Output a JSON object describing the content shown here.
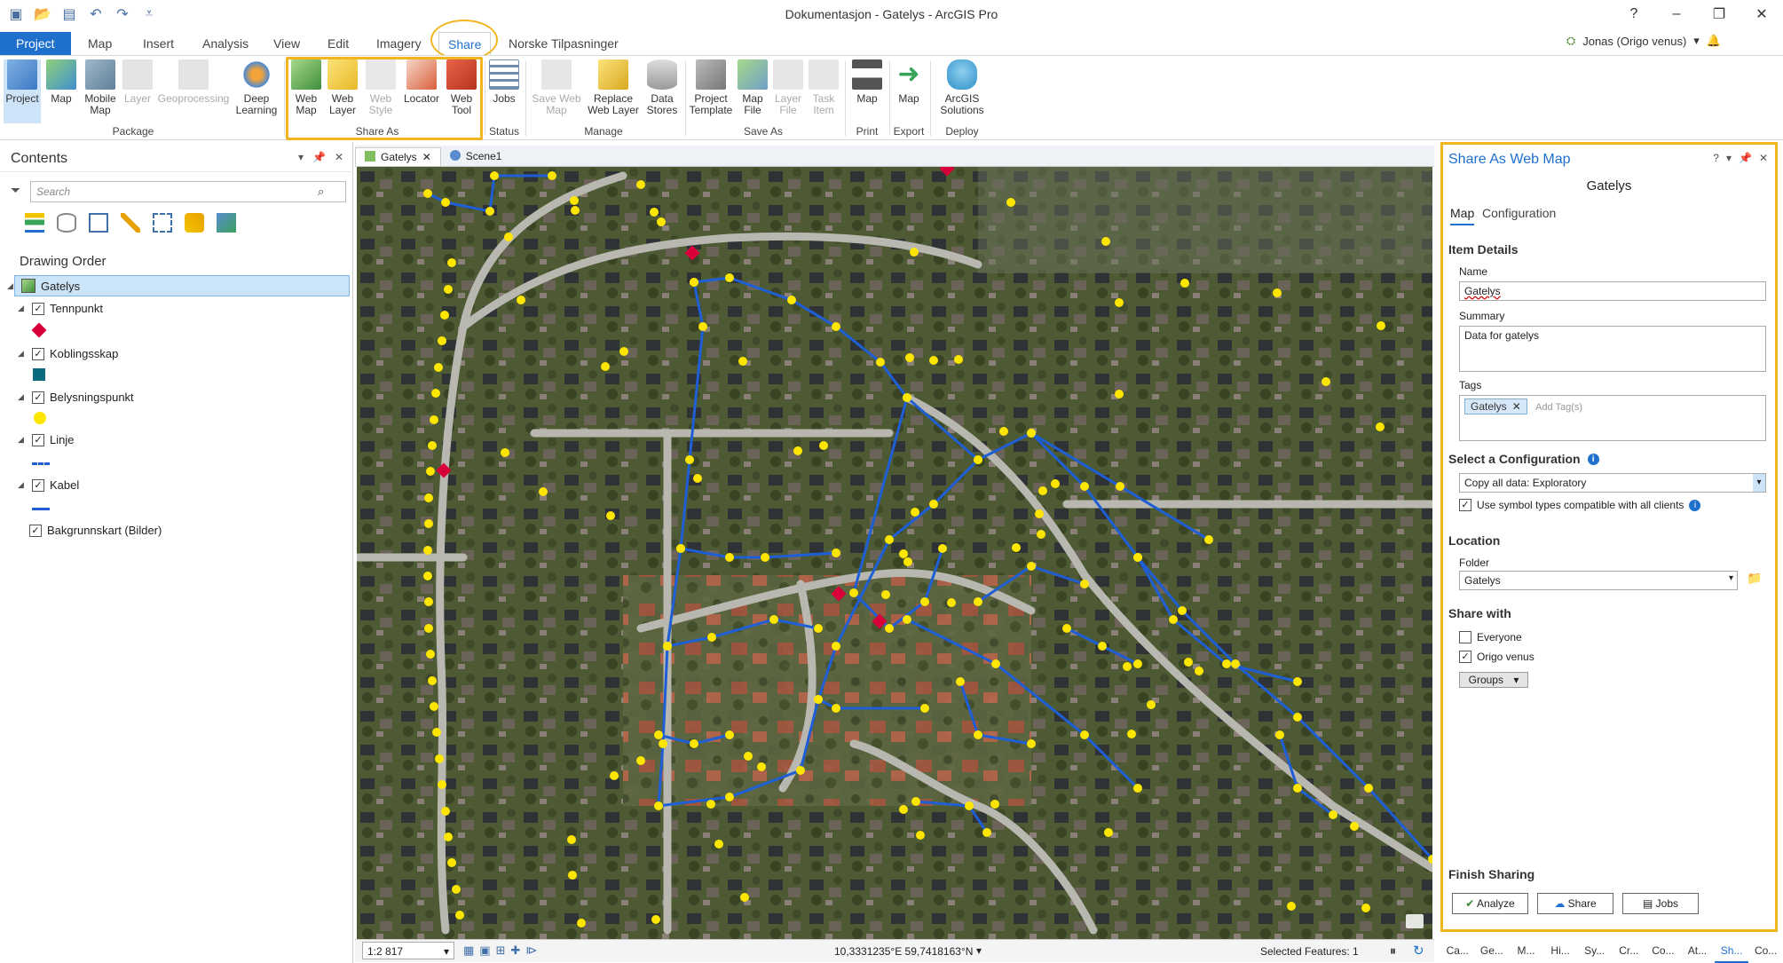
{
  "window": {
    "title": "Dokumentasjon - Gatelys - ArcGIS Pro",
    "help": "?",
    "minimize": "–",
    "restore": "❐",
    "close": "✕"
  },
  "tabs": [
    "Project",
    "Map",
    "Insert",
    "Analysis",
    "View",
    "Edit",
    "Imagery",
    "Share",
    "Norske Tilpasninger"
  ],
  "user": "Jonas (Origo venus)",
  "ribbon": {
    "package": {
      "label": "Package",
      "buttons": [
        "Project",
        "Map",
        "Mobile Map",
        "Layer",
        "Geoprocessing",
        "Deep Learning"
      ]
    },
    "share_as": {
      "label": "Share As",
      "buttons": [
        "Web Map",
        "Web Layer",
        "Web Style",
        "Locator",
        "Web Tool"
      ]
    },
    "status": {
      "label": "Status",
      "buttons": [
        "Jobs"
      ]
    },
    "manage": {
      "label": "Manage",
      "buttons": [
        "Save Web Map",
        "Replace Web Layer",
        "Data Stores"
      ]
    },
    "save_as": {
      "label": "Save As",
      "buttons": [
        "Project Template",
        "Map File",
        "Layer File",
        "Task Item"
      ]
    },
    "print": {
      "label": "Print",
      "buttons": [
        "Map"
      ]
    },
    "export": {
      "label": "Export",
      "buttons": [
        "Map"
      ]
    },
    "deploy": {
      "label": "Deploy",
      "buttons": [
        "ArcGIS Solutions"
      ]
    }
  },
  "contents": {
    "title": "Contents",
    "search_placeholder": "Search",
    "drawing_order": "Drawing Order",
    "map_name": "Gatelys",
    "layers": [
      "Tennpunkt",
      "Koblingsskap",
      "Belysningspunkt",
      "Linje",
      "Kabel",
      "Bakgrunnskart (Bilder)"
    ]
  },
  "map": {
    "tabs": [
      "Gatelys",
      "Scene1"
    ],
    "scale": "1:2 817",
    "coords": "10,3331235°E 59,7418163°N",
    "selected": "Selected Features: 1"
  },
  "share": {
    "title": "Share As Web Map",
    "item": "Gatelys",
    "tabs": [
      "Map",
      "Configuration"
    ],
    "item_details": "Item Details",
    "name_label": "Name",
    "name_value": "Gatelys",
    "summary_label": "Summary",
    "summary_value": "Data for gatelys",
    "tags_label": "Tags",
    "tag": "Gatelys",
    "tag_placeholder": "Add Tag(s)",
    "config_header": "Select a Configuration",
    "config_value": "Copy all data: Exploratory",
    "symbol_check": "Use symbol types compatible with all clients",
    "location": "Location",
    "folder_label": "Folder",
    "folder_value": "Gatelys",
    "share_with": "Share with",
    "everyone": "Everyone",
    "org": "Origo venus",
    "groups": "Groups",
    "finish": "Finish Sharing",
    "analyze": "Analyze",
    "share_btn": "Share",
    "jobs_btn": "Jobs"
  },
  "bottom_tabs": [
    "Ca...",
    "Ge...",
    "M...",
    "Hi...",
    "Sy...",
    "Cr...",
    "Co...",
    "At...",
    "Sh...",
    "Co..."
  ],
  "colors": {
    "accent": "#1f6fcd",
    "highlight": "#f2b51f",
    "point": "#ffe600",
    "line": "#1f5fd6",
    "marker": "#d9003a"
  }
}
